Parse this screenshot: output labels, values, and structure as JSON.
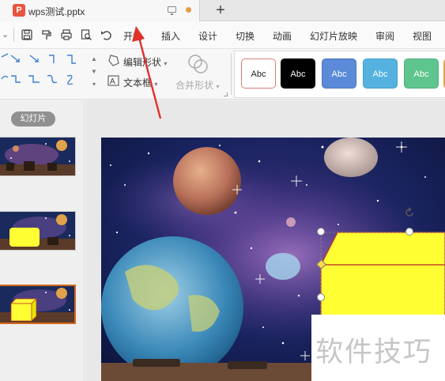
{
  "tabbar": {
    "app_icon_letter": "P",
    "doc_title": "wps测试.pptx",
    "new_tab_label": "+",
    "unsaved_dot_color": "#e39a48"
  },
  "quick_access": {
    "icons": [
      "save-icon",
      "format-painter-icon",
      "print-icon",
      "print-preview-icon",
      "undo-icon"
    ]
  },
  "menu": {
    "items": [
      "开始",
      "插入",
      "设计",
      "切换",
      "动画",
      "幻灯片放映",
      "审阅",
      "视图"
    ]
  },
  "ribbon": {
    "edit_shape_label": "编辑形状",
    "textbox_label": "文本框",
    "merge_shapes_label": "合并形状",
    "style_presets": [
      {
        "label": "Abc",
        "bg": "#ffffff",
        "fg": "#222222",
        "border": "#e07a7a"
      },
      {
        "label": "Abc",
        "bg": "#000000",
        "fg": "#ffffff",
        "border": "#000000"
      },
      {
        "label": "Abc",
        "bg": "#5b8bd8",
        "fg": "#ffffff",
        "border": "#4a74b8"
      },
      {
        "label": "Abc",
        "bg": "#55b2e0",
        "fg": "#ffffff",
        "border": "#46a0cc"
      },
      {
        "label": "Abc",
        "bg": "#5fc58f",
        "fg": "#ffffff",
        "border": "#4eae7c"
      }
    ]
  },
  "left_panel": {
    "tab_label": "幻灯片",
    "thumbnails": [
      {
        "number": "1"
      },
      {
        "number": "2"
      },
      {
        "number": "3"
      }
    ]
  },
  "watermark_text": "软件技巧",
  "colors": {
    "accent_orange": "#d4691a",
    "arrow_red": "#e0312a",
    "shape_yellow": "#ffff33"
  }
}
